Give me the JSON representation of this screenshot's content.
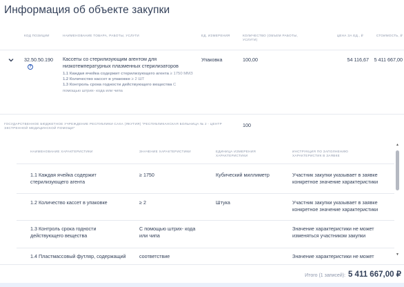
{
  "page": {
    "title": "Информация об объекте закупки"
  },
  "table": {
    "headers": {
      "code": "КОД ПОЗИЦИИ",
      "name": "НАИМЕНОВАНИЕ ТОВАРА, РАБОТЫ, УСЛУГИ",
      "unit": "ЕД. ИЗМЕРЕНИЯ",
      "qty": "КОЛИЧЕСТВО (ОБЪЕМ РАБОТЫ, УСЛУГИ)",
      "price": "ЦЕНА ЗА ЕД., ₽",
      "cost": "СТОИМОСТЬ, ₽"
    },
    "row": {
      "code": "32.50.50.190",
      "name": "Кассеты со стерилизующим агентом для низкотемпературных плазменных стерилизаторов",
      "char1_label": "1.1 Каждая ячейка содержит стерилизующего агента",
      "char1_value": "≥ 1750 ММЗ",
      "char2_label": "1.2 Количество кассет в упаковке",
      "char2_value": "≥ 2 ШТ",
      "char3_label": "1.3 Контроль срока годности действующего вещества",
      "char3_value": "С помощью штрих- кода или чипа",
      "unit": "Упаковка",
      "qty": "100,00",
      "price": "54 116,67",
      "cost": "5 411 667,00"
    }
  },
  "customer": {
    "name": "ГОСУДАРСТВЕННОЕ БЮДЖЕТНОЕ УЧРЕЖДЕНИЕ РЕСПУБЛИКИ САХА (ЯКУТИЯ) \"РЕСПУБЛИКАНСКАЯ БОЛЬНИЦА № 2 - ЦЕНТР ЭКСТРЕННОЙ МЕДИЦИНСКОЙ ПОМОЩИ\"",
    "qty": "100"
  },
  "characteristics": {
    "headers": {
      "name": "НАИМЕНОВАНИЕ ХАРАКТЕРИСТИКИ",
      "value": "ЗНАЧЕНИЕ ХАРАКТЕРИСТИКИ",
      "unit": "ЕДИНИЦА ИЗМЕРЕНИЯ ХАРАКТЕРИСТИКИ",
      "instruction": "ИНСТРУКЦИЯ ПО ЗАПОЛНЕНИЮ ХАРАКТЕРИСТИК В ЗАЯВКЕ"
    },
    "rows": [
      {
        "name": "1.1 Каждая ячейка содержит стерилизующего агента",
        "value": "≥ 1750",
        "unit": "Кубический миллиметр",
        "instruction": "Участник закупки указывает в заявке конкретное значение характеристики"
      },
      {
        "name": "1.2 Количество кассет в упаковке",
        "value": "≥ 2",
        "unit": "Штука",
        "instruction": "Участник закупки указывает в заявке конкретное значение характеристики"
      },
      {
        "name": "1.3 Контроль срока годности действующего вещества",
        "value": "С помощью штрих- кода или чипа",
        "unit": "",
        "instruction": "Значение характеристики не может изменяться участником закупки"
      },
      {
        "name": "1.4 Пластмассовый футляр, содержащий",
        "value": "соответствие",
        "unit": "",
        "instruction": "Значение характеристики не может"
      }
    ]
  },
  "footer": {
    "total_label": "Итого (1 записей):",
    "total_value": "5 411 667,00 ₽"
  },
  "colors": {
    "text": "#334059",
    "muted": "#8c96ab",
    "link": "#2b5ab8",
    "divider": "#e6e9ef"
  }
}
